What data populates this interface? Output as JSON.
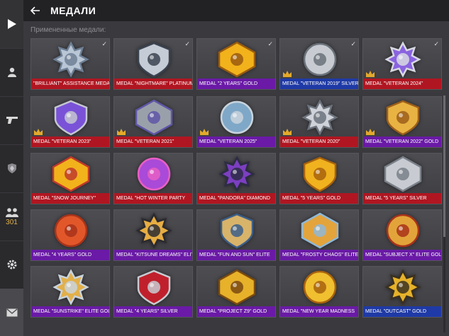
{
  "header": {
    "title": "МЕДАЛИ"
  },
  "applied_label": "Примененные медали:",
  "sidebar": {
    "clan_count": "301"
  },
  "applied": [
    {
      "label": "\"BRILLIANT\" ASSISTANCE MEDAL",
      "color": "red",
      "main": "#b9c6d6",
      "accent": "#6e7f95",
      "veteran": false
    },
    {
      "label": "MEDAL \"NIGHTMARE\" PLATINUM",
      "color": "red",
      "main": "#c6ccd6",
      "accent": "#3a4350",
      "veteran": false
    },
    {
      "label": "MEDAL \"2 YEARS\" GOLD",
      "color": "purple",
      "main": "#f2b21b",
      "accent": "#9a5b0f",
      "veteran": false
    },
    {
      "label": "MEDAL \"VETERAN 2019\" SILVER",
      "color": "blue",
      "main": "#c8ccd2",
      "accent": "#6b717a",
      "veteran": true
    },
    {
      "label": "MEDAL \"VETERAN 2024\"",
      "color": "red",
      "main": "#8a63e0",
      "accent": "#d7d9e0",
      "veteran": true
    }
  ],
  "medals": [
    {
      "label": "MEDAL \"VETERAN 2023\"",
      "color": "red",
      "main": "#7a52d8",
      "accent": "#c4c7d0",
      "veteran": true
    },
    {
      "label": "MEDAL \"VETERAN 2021\"",
      "color": "red",
      "main": "#9aa0aa",
      "accent": "#5f56a8",
      "veteran": true
    },
    {
      "label": "MEDAL \"VETERAN 2025\"",
      "color": "purple",
      "main": "#7fa8c8",
      "accent": "#c9d3dc",
      "veteran": true
    },
    {
      "label": "MEDAL \"VETERAN 2020\"",
      "color": "red",
      "main": "#cfd3d9",
      "accent": "#6c727c",
      "veteran": true
    },
    {
      "label": "MEDAL \"VETERAN 2022\" GOLD",
      "color": "purple",
      "main": "#e9b343",
      "accent": "#9c5e1a",
      "veteran": true
    },
    {
      "label": "MEDAL \"SNOW JOURNEY\"",
      "color": "red",
      "main": "#f2b21b",
      "accent": "#c0392b",
      "veteran": false
    },
    {
      "label": "MEDAL \"HOT WINTER PARTY",
      "color": "red",
      "main": "#a94ad8",
      "accent": "#e85fc4",
      "veteran": false
    },
    {
      "label": "MEDAL \"PANDORA\" DIAMOND",
      "color": "red",
      "main": "#7c3fc0",
      "accent": "#2c2c44",
      "veteran": false
    },
    {
      "label": "MEDAL \"5 YEARS\" GOLD",
      "color": "red",
      "main": "#f0b21e",
      "accent": "#a8620e",
      "veteran": false
    },
    {
      "label": "MEDAL \"5 YEARS\" SILVER",
      "color": "red",
      "main": "#c8ccd2",
      "accent": "#7a8089",
      "veteran": false
    },
    {
      "label": "MEDAL \"4 YEARS\" GOLD",
      "color": "purple",
      "main": "#e2572a",
      "accent": "#a8331a",
      "veteran": false
    },
    {
      "label": "MEDAL \"KITSUNE DREAMS\" ELITE",
      "color": "purple",
      "main": "#e6ad43",
      "accent": "#2a2a30",
      "veteran": false
    },
    {
      "label": "MEDAL \"FUN AND SUN\" ELITE",
      "color": "purple",
      "main": "#d8b36a",
      "accent": "#3b5f8a",
      "veteran": false
    },
    {
      "label": "MEDAL \"FROSTY CHAOS\" ELITE",
      "color": "purple",
      "main": "#e4a43c",
      "accent": "#8fb8d8",
      "veteran": false
    },
    {
      "label": "MEDAL \"SUBJECT X\" ELITE GOLD",
      "color": "purple",
      "main": "#e2a43a",
      "accent": "#a8331a",
      "veteran": false
    },
    {
      "label": "MEDAL \"SUNSTRIKE\" ELITE GOLD",
      "color": "purple",
      "main": "#e2b04a",
      "accent": "#c9d3dc",
      "veteran": false
    },
    {
      "label": "MEDAL \"4 YEARS\" SILVER",
      "color": "purple",
      "main": "#c0202c",
      "accent": "#c8ccd2",
      "veteran": false
    },
    {
      "label": "MEDAL \"PROJECT Z9\" GOLD",
      "color": "purple",
      "main": "#e7b12a",
      "accent": "#7a4a10",
      "veteran": false
    },
    {
      "label": "MEDAL \"NEW YEAR MADNESS",
      "color": "purple",
      "main": "#f0c030",
      "accent": "#a8620e",
      "veteran": false
    },
    {
      "label": "MEDAL \"OUTCAST\" GOLD",
      "color": "blue",
      "main": "#e6b22a",
      "accent": "#3a3020",
      "veteran": false
    }
  ]
}
